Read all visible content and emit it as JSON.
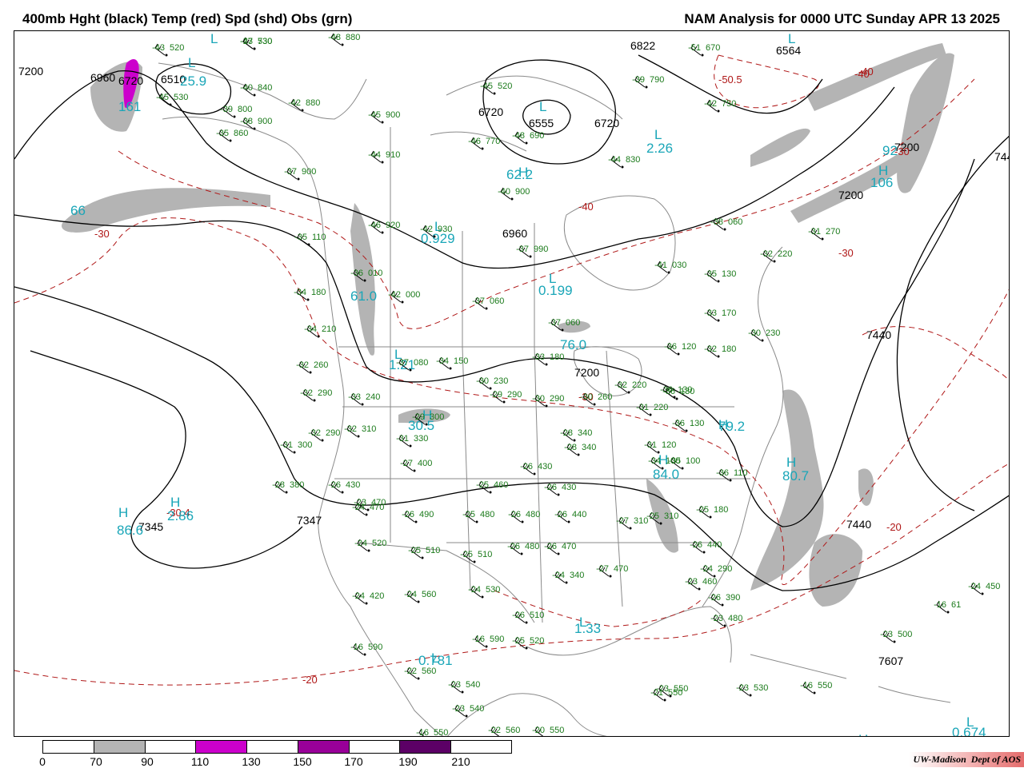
{
  "header": {
    "left_title": "400mb Hght (black) Temp (red) Spd (shd) Obs (grn)",
    "right_title": "NAM Analysis for 0000 UTC Sunday  APR 13 2025"
  },
  "colors": {
    "height_contour": "#000000",
    "temperature_contour": "#b01818",
    "speed_label": "#1aa6b8",
    "observation": "#1a7a1a",
    "speed_70_90": "#b4b4b4",
    "speed_110_130": "#cc00cc",
    "speed_150_170": "#990099",
    "speed_190_210": "#5c0066"
  },
  "map_labels": {
    "height_values": [
      {
        "text": "7200"
      },
      {
        "text": "6960"
      },
      {
        "text": "6720"
      },
      {
        "text": "6510"
      },
      {
        "text": "6822"
      },
      {
        "text": "6564"
      },
      {
        "text": "6720"
      },
      {
        "text": "6555"
      },
      {
        "text": "6720"
      },
      {
        "text": "7200"
      },
      {
        "text": "6960"
      },
      {
        "text": "7200"
      },
      {
        "text": "7200"
      },
      {
        "text": "7440"
      },
      {
        "text": "7440"
      },
      {
        "text": "7440"
      },
      {
        "text": "7345"
      },
      {
        "text": "7347"
      },
      {
        "text": "7607"
      }
    ],
    "high_low_letters": [
      {
        "text": "L"
      },
      {
        "text": "L"
      },
      {
        "text": "L"
      },
      {
        "text": "L"
      },
      {
        "text": "L"
      },
      {
        "text": "L"
      },
      {
        "text": "L"
      },
      {
        "text": "L"
      },
      {
        "text": "L"
      },
      {
        "text": "L"
      },
      {
        "text": "H"
      },
      {
        "text": "H"
      },
      {
        "text": "H"
      },
      {
        "text": "H"
      },
      {
        "text": "H"
      },
      {
        "text": "H"
      },
      {
        "text": "H"
      },
      {
        "text": "H"
      },
      {
        "text": "H"
      },
      {
        "text": "L"
      }
    ],
    "temperature_values": [
      {
        "text": "-30"
      },
      {
        "text": "-40"
      },
      {
        "text": "-40"
      },
      {
        "text": "-50.5"
      },
      {
        "text": "-30"
      },
      {
        "text": "-30"
      },
      {
        "text": "-30"
      },
      {
        "text": "-20"
      },
      {
        "text": "-20"
      },
      {
        "text": "-30.4"
      },
      {
        "text": "-40"
      }
    ],
    "speed_values": [
      {
        "text": "25.9"
      },
      {
        "text": "161"
      },
      {
        "text": "62.2"
      },
      {
        "text": "2.26"
      },
      {
        "text": "106"
      },
      {
        "text": "92"
      },
      {
        "text": "66"
      },
      {
        "text": "0.929"
      },
      {
        "text": "0.199"
      },
      {
        "text": "61.0"
      },
      {
        "text": "76.0"
      },
      {
        "text": "1.21"
      },
      {
        "text": "30.5"
      },
      {
        "text": "84.0"
      },
      {
        "text": "80.7"
      },
      {
        "text": "86.6"
      },
      {
        "text": "2.86"
      },
      {
        "text": "1.33"
      },
      {
        "text": "0.781"
      },
      {
        "text": "0.674"
      },
      {
        "text": "79.2"
      }
    ],
    "observations": [
      {
        "temp": "-47",
        "hgt": "730"
      },
      {
        "temp": "-48",
        "hgt": "880"
      },
      {
        "temp": "-43",
        "hgt": "520"
      },
      {
        "temp": "-45",
        "hgt": "530"
      },
      {
        "temp": "-40",
        "hgt": "840"
      },
      {
        "temp": "-39",
        "hgt": "800"
      },
      {
        "temp": "-42",
        "hgt": "880"
      },
      {
        "temp": "-38",
        "hgt": "900"
      },
      {
        "temp": "-35",
        "hgt": "860"
      },
      {
        "temp": "-45",
        "hgt": "900"
      },
      {
        "temp": "-45",
        "hgt": "520"
      },
      {
        "temp": "-46",
        "hgt": "770"
      },
      {
        "temp": "-48",
        "hgt": "690"
      },
      {
        "temp": "-51",
        "hgt": "670"
      },
      {
        "temp": "-39",
        "hgt": "790"
      },
      {
        "temp": "-42",
        "hgt": "750"
      },
      {
        "temp": "-44",
        "hgt": "910"
      },
      {
        "temp": "-44",
        "hgt": "830"
      },
      {
        "temp": "-37",
        "hgt": "900"
      },
      {
        "temp": "-40",
        "hgt": "900"
      },
      {
        "temp": "-46",
        "hgt": "920"
      },
      {
        "temp": "-42",
        "hgt": "930"
      },
      {
        "temp": "-35",
        "hgt": "110"
      },
      {
        "temp": "-37",
        "hgt": "990"
      },
      {
        "temp": "-38",
        "hgt": "060"
      },
      {
        "temp": "-41",
        "hgt": "030"
      },
      {
        "temp": "-35",
        "hgt": "130"
      },
      {
        "temp": "-31",
        "hgt": "270"
      },
      {
        "temp": "-32",
        "hgt": "220"
      },
      {
        "temp": "-36",
        "hgt": "010"
      },
      {
        "temp": "-34",
        "hgt": "180"
      },
      {
        "temp": "-42",
        "hgt": "000"
      },
      {
        "temp": "-37",
        "hgt": "060"
      },
      {
        "temp": "-37",
        "hgt": "060"
      },
      {
        "temp": "-33",
        "hgt": "170"
      },
      {
        "temp": "-30",
        "hgt": "230"
      },
      {
        "temp": "-34",
        "hgt": "210"
      },
      {
        "temp": "-36",
        "hgt": "120"
      },
      {
        "temp": "-32",
        "hgt": "180"
      },
      {
        "temp": "-32",
        "hgt": "260"
      },
      {
        "temp": "-37",
        "hgt": "080"
      },
      {
        "temp": "-34",
        "hgt": "150"
      },
      {
        "temp": "-33",
        "hgt": "180"
      },
      {
        "temp": "-30",
        "hgt": "230"
      },
      {
        "temp": "-36",
        "hgt": "130"
      },
      {
        "temp": "-32",
        "hgt": "290"
      },
      {
        "temp": "-33",
        "hgt": "240"
      },
      {
        "temp": "-29",
        "hgt": "290"
      },
      {
        "temp": "-30",
        "hgt": "290"
      },
      {
        "temp": "-30",
        "hgt": "260"
      },
      {
        "temp": "-32",
        "hgt": "220"
      },
      {
        "temp": "-36",
        "hgt": "130"
      },
      {
        "temp": "-31",
        "hgt": "220"
      },
      {
        "temp": "-36",
        "hgt": "130"
      },
      {
        "temp": "-29",
        "hgt": "300"
      },
      {
        "temp": "-32",
        "hgt": "290"
      },
      {
        "temp": "-32",
        "hgt": "310"
      },
      {
        "temp": "-31",
        "hgt": "300"
      },
      {
        "temp": "-31",
        "hgt": "330"
      },
      {
        "temp": "-28",
        "hgt": "340"
      },
      {
        "temp": "-31",
        "hgt": "120"
      },
      {
        "temp": "-35",
        "hgt": "100"
      },
      {
        "temp": "-28",
        "hgt": "340"
      },
      {
        "temp": "-27",
        "hgt": "400"
      },
      {
        "temp": "-26",
        "hgt": "430"
      },
      {
        "temp": "-34",
        "hgt": "100"
      },
      {
        "temp": "-36",
        "hgt": "110"
      },
      {
        "temp": "-28",
        "hgt": "380"
      },
      {
        "temp": "-26",
        "hgt": "430"
      },
      {
        "temp": "-25",
        "hgt": "460"
      },
      {
        "temp": "-26",
        "hgt": "430"
      },
      {
        "temp": "-23",
        "hgt": "470"
      },
      {
        "temp": "-24",
        "hgt": "470"
      },
      {
        "temp": "-26",
        "hgt": "490"
      },
      {
        "temp": "-25",
        "hgt": "480"
      },
      {
        "temp": "-26",
        "hgt": "480"
      },
      {
        "temp": "-26",
        "hgt": "440"
      },
      {
        "temp": "-27",
        "hgt": "310"
      },
      {
        "temp": "-25",
        "hgt": "310"
      },
      {
        "temp": "-25",
        "hgt": "180"
      },
      {
        "temp": "-24",
        "hgt": "520"
      },
      {
        "temp": "-25",
        "hgt": "510"
      },
      {
        "temp": "-25",
        "hgt": "510"
      },
      {
        "temp": "-26",
        "hgt": "480"
      },
      {
        "temp": "-26",
        "hgt": "470"
      },
      {
        "temp": "-26",
        "hgt": "440"
      },
      {
        "temp": "-24",
        "hgt": "290"
      },
      {
        "temp": "-24",
        "hgt": "340"
      },
      {
        "temp": "-27",
        "hgt": "470"
      },
      {
        "temp": "-23",
        "hgt": "460"
      },
      {
        "temp": "-26",
        "hgt": "390"
      },
      {
        "temp": "-24",
        "hgt": "420"
      },
      {
        "temp": "-24",
        "hgt": "560"
      },
      {
        "temp": "-24",
        "hgt": "530"
      },
      {
        "temp": "-26",
        "hgt": "510"
      },
      {
        "temp": "-23",
        "hgt": "480"
      },
      {
        "temp": "-24",
        "hgt": "450"
      },
      {
        "temp": "-16",
        "hgt": "61"
      },
      {
        "temp": "-16",
        "hgt": "590"
      },
      {
        "temp": "-25",
        "hgt": "520"
      },
      {
        "temp": "-23",
        "hgt": "500"
      },
      {
        "temp": "-16",
        "hgt": "590"
      },
      {
        "temp": "-22",
        "hgt": "560"
      },
      {
        "temp": "-23",
        "hgt": "540"
      },
      {
        "temp": "-23",
        "hgt": "540"
      },
      {
        "temp": "-21",
        "hgt": "550"
      },
      {
        "temp": "-23",
        "hgt": "550"
      },
      {
        "temp": "-23",
        "hgt": "530"
      },
      {
        "temp": "-16",
        "hgt": "550"
      },
      {
        "temp": "-16",
        "hgt": "550"
      },
      {
        "temp": "-22",
        "hgt": "560"
      },
      {
        "temp": "-20",
        "hgt": "550"
      },
      {
        "temp": "-23",
        "hgt": "530"
      }
    ]
  },
  "legend": {
    "title": "Spd (shd)",
    "segments": [
      {
        "range": "0-70",
        "color": "#ffffff"
      },
      {
        "range": "70-90",
        "color": "#b4b4b4"
      },
      {
        "range": "90-110",
        "color": "#ffffff"
      },
      {
        "range": "110-130",
        "color": "#cc00cc"
      },
      {
        "range": "130-150",
        "color": "#ffffff"
      },
      {
        "range": "150-170",
        "color": "#990099"
      },
      {
        "range": "170-190",
        "color": "#ffffff"
      },
      {
        "range": "190-210",
        "color": "#5c0066"
      },
      {
        "range": "210+",
        "color": "#ffffff"
      }
    ],
    "ticks": [
      "0",
      "70",
      "90",
      "110",
      "130",
      "150",
      "170",
      "190",
      "210"
    ]
  },
  "footer": {
    "credit_org": "UW-Madison",
    "credit_dept": "Dept of AOS"
  }
}
